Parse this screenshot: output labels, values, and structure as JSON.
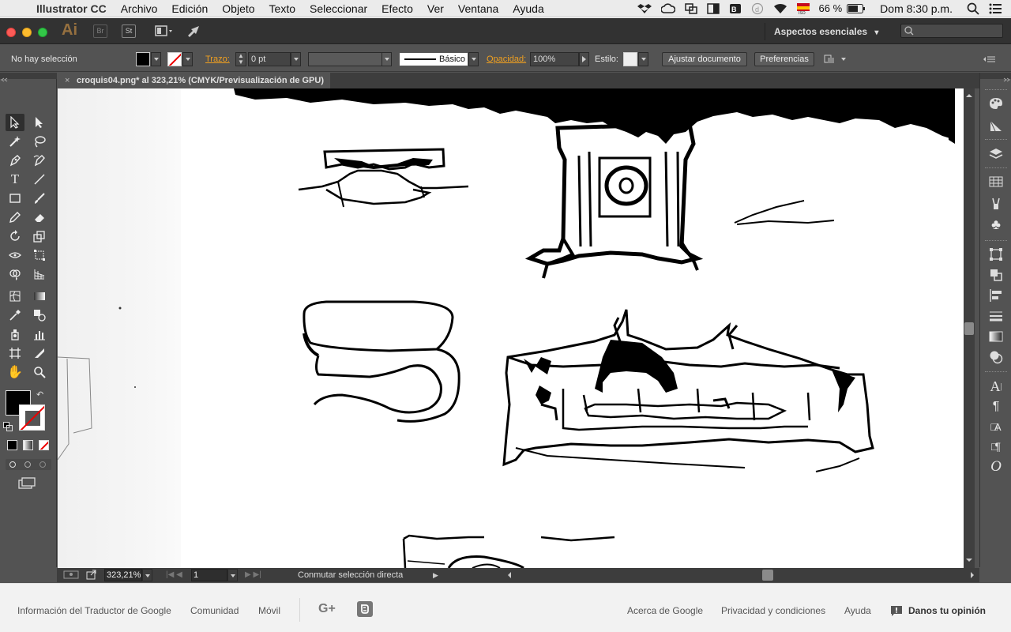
{
  "menubar": {
    "app_name": "Illustrator CC",
    "items": [
      "Archivo",
      "Edición",
      "Objeto",
      "Texto",
      "Seleccionar",
      "Efecto",
      "Ver",
      "Ventana",
      "Ayuda"
    ],
    "battery": "66 %",
    "clock": "Dom 8:30 p.m."
  },
  "titlebar": {
    "logo": "Ai",
    "br": "Br",
    "st": "St",
    "workspace": "Aspectos esenciales",
    "workspace_arrow": "▾"
  },
  "control": {
    "selection_status": "No hay selección",
    "stroke_label": "Trazo:",
    "stroke_value": "0 pt",
    "brush_label": "Básico",
    "opacity_label": "Opacidad:",
    "opacity_value": "100%",
    "style_label": "Estilo:",
    "fit_button": "Ajustar documento",
    "prefs_button": "Preferencias"
  },
  "document": {
    "tab_close": "×",
    "tab_title": "croquis04.png* al 323,21% (CMYK/Previsualización de GPU)"
  },
  "status": {
    "zoom": "323,21%",
    "page": "1",
    "tool_status": "Conmutar selección directa"
  },
  "footer": {
    "links_left": [
      "Información del Traductor de Google",
      "Comunidad",
      "Móvil"
    ],
    "links_right": [
      "Acerca de Google",
      "Privacidad y condiciones",
      "Ayuda"
    ],
    "feedback": "Danos tu opinión",
    "gplus": "G+"
  },
  "icons": {
    "apple": "apple-icon",
    "dropbox": "dropbox-icon",
    "wifi": "wifi-icon",
    "battery": "battery-icon",
    "search": "search-icon"
  },
  "colors": {
    "accent_orange": "#f0a020",
    "panel_gray": "#535353",
    "canvas_white": "#ffffff"
  }
}
